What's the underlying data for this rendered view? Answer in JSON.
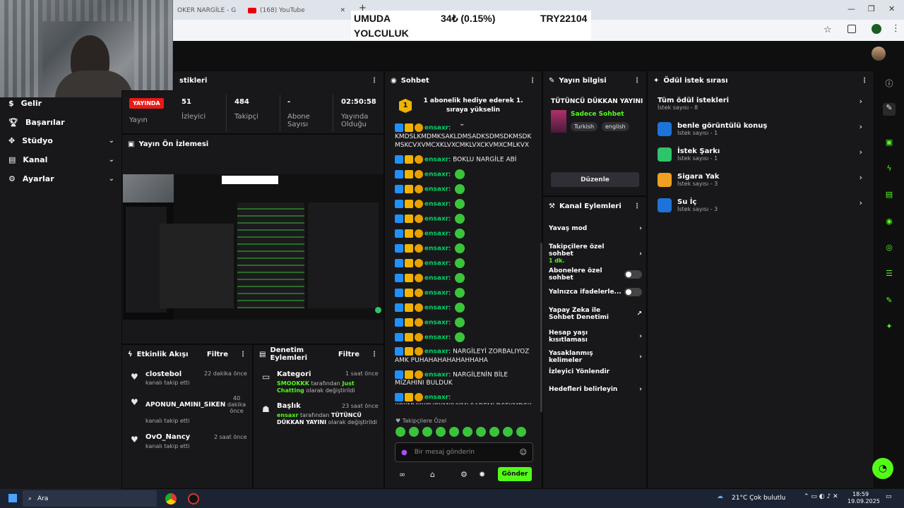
{
  "browser": {
    "tabs": [
      {
        "label": "OKER NARGİLE - G"
      },
      {
        "label": "(168) YouTube"
      }
    ],
    "new_tab": "+"
  },
  "ticker": {
    "left": "UMUDA",
    "left2": "YOLCULUK",
    "mid": "34₺ (0.15%)",
    "right": "TRY22104"
  },
  "nav": [
    {
      "label": "Gelir",
      "icon": "money-icon",
      "chev": ""
    },
    {
      "label": "Başarılar",
      "icon": "trophy-icon",
      "chev": ""
    },
    {
      "label": "Stüdyo",
      "icon": "studio-icon",
      "chev": "⌄"
    },
    {
      "label": "Kanal",
      "icon": "channel-icon",
      "chev": "⌄"
    },
    {
      "label": "Ayarlar",
      "icon": "gear-icon",
      "chev": "⌄"
    }
  ],
  "stats": {
    "header": "stikleri",
    "live": "YAYINDA",
    "live_label": "Yayın",
    "viewers": "51",
    "viewers_label": "İzleyici",
    "followers": "484",
    "followers_label": "Takipçi",
    "subs": "-",
    "subs_label": "Abone Sayısı",
    "uptime": "02:50:58",
    "uptime_label": "Yayında Olduğu"
  },
  "preview": {
    "title": "Yayın Ön İzlemesi"
  },
  "activity": {
    "title": "Etkinlik Akışı",
    "filter": "Filtre",
    "items": [
      {
        "user": "clostebol",
        "action": "kanalı takip etti",
        "time": "22 dakika önce"
      },
      {
        "user": "APONUN_AMINI_SIKEN",
        "action": "kanalı takip etti",
        "time": "40 dakika önce"
      },
      {
        "user": "OvO_Nancy",
        "action": "kanalı takip etti",
        "time": "2 saat önce"
      }
    ]
  },
  "moderation": {
    "title": "Denetim Eylemleri",
    "filter": "Filtre",
    "items": [
      {
        "title": "Kategori",
        "time": "1 saat önce",
        "who": "SMOOKKK",
        "mid": "tarafından",
        "value": "Just Chatting",
        "tail": "olarak değiştirildi"
      },
      {
        "title": "Başlık",
        "time": "23 saat önce",
        "who": "ensaxr",
        "mid": "tarafından",
        "value": "TÜTÜNCÜ DÜKKAN YAYINI",
        "tail": "olarak değiştirildi"
      }
    ]
  },
  "chat": {
    "title": "Sohbet",
    "gift_rank": "1",
    "gift_text": "1 abonelik hediye ederek 1. sıraya yükselin",
    "messages": [
      {
        "user": "ensaxr",
        "text": "KMDSLKMDMKSAKLDMSADKSDMSDKMSDK MSKCVXVMCXKLVXCMKLVXCKVMXCMLKVX",
        "emote": false
      },
      {
        "user": "ensaxr",
        "text": "BOKLU NARGİLE ABİ",
        "emote": false
      },
      {
        "user": "ensaxr",
        "text": "",
        "emote": true
      },
      {
        "user": "ensaxr",
        "text": "",
        "emote": true
      },
      {
        "user": "ensaxr",
        "text": "",
        "emote": true
      },
      {
        "user": "ensaxr",
        "text": "",
        "emote": true
      },
      {
        "user": "ensaxr",
        "text": "",
        "emote": true
      },
      {
        "user": "ensaxr",
        "text": "",
        "emote": true
      },
      {
        "user": "ensaxr",
        "text": "",
        "emote": true
      },
      {
        "user": "ensaxr",
        "text": "",
        "emote": true
      },
      {
        "user": "ensaxr",
        "text": "",
        "emote": true
      },
      {
        "user": "ensaxr",
        "text": "",
        "emote": true
      },
      {
        "user": "ensaxr",
        "text": "",
        "emote": true
      },
      {
        "user": "ensaxr",
        "text": "",
        "emote": true
      },
      {
        "user": "ensaxr",
        "text": "NARGİLEYİ ZORBALIYOZ AMK PUHAHAHAHAHAHHAHA",
        "emote": false
      },
      {
        "user": "ensaxr",
        "text": "NARGİLENİN BİLE MİZAHINI BULDUK",
        "emote": false
      },
      {
        "user": "ensaxr",
        "text": "KCXMVKXCVCXMKVKMLSADFMLDSFKMDSK MFSDMKFSKMD",
        "emote": false
      }
    ],
    "followers_only": "Takipçilere Özel",
    "input_placeholder": "Bir mesaj gönderin",
    "send": "Gönder"
  },
  "stream_info": {
    "title": "Yayın bilgisi",
    "stream_title": "TÜTÜNCÜ DÜKKAN YAYINI",
    "category": "Sadece Sohbet",
    "tags": [
      "Turkish",
      "english"
    ],
    "edit": "Düzenle"
  },
  "channel_actions": {
    "title": "Kanal Eylemleri",
    "items": [
      {
        "label": "Yavaş mod",
        "sub": "",
        "control": "chevron"
      },
      {
        "label": "Takipçilere özel sohbet",
        "sub": "1 dk.",
        "control": "chevron"
      },
      {
        "label": "Abonelere özel sohbet",
        "sub": "",
        "control": "toggle"
      },
      {
        "label": "Yalnızca ifadelerle...",
        "sub": "",
        "control": "toggle"
      },
      {
        "label": "Yapay Zeka ile Sohbet Denetimi",
        "sub": "",
        "control": "external"
      },
      {
        "label": "Hesap yaşı kısıtlaması",
        "sub": "",
        "control": "chevron"
      },
      {
        "label": "Yasaklanmış kelimeler",
        "sub": "",
        "control": "chevron"
      },
      {
        "label": "İzleyici Yönlendir",
        "sub": "",
        "control": "none"
      },
      {
        "label": "Hedefleri belirleyin",
        "sub": "",
        "control": "chevron"
      }
    ]
  },
  "rewards": {
    "title": "Ödül istek sırası",
    "all": "Tüm ödül istekleri",
    "all_count": "İstek sayısı - 8",
    "items": [
      {
        "title": "benle görüntülü konuş",
        "count": "İstek sayısı - 1",
        "color": "#1e73d8"
      },
      {
        "title": "İstek Şarkı",
        "count": "İstek sayısı - 1",
        "color": "#2ec46a"
      },
      {
        "title": "Sigara Yak",
        "count": "İstek sayısı - 3",
        "color": "#f0a020"
      },
      {
        "title": "Su İç",
        "count": "İstek sayısı - 3",
        "color": "#1e73d8"
      }
    ]
  },
  "taskbar": {
    "search": "Ara",
    "weather": "21°C  Çok bulutlu",
    "time": "18:59",
    "date": "19.09.2025"
  },
  "colors": {
    "accent": "#53fc18",
    "live": "#e91916",
    "chat_user": "#00d26a"
  }
}
